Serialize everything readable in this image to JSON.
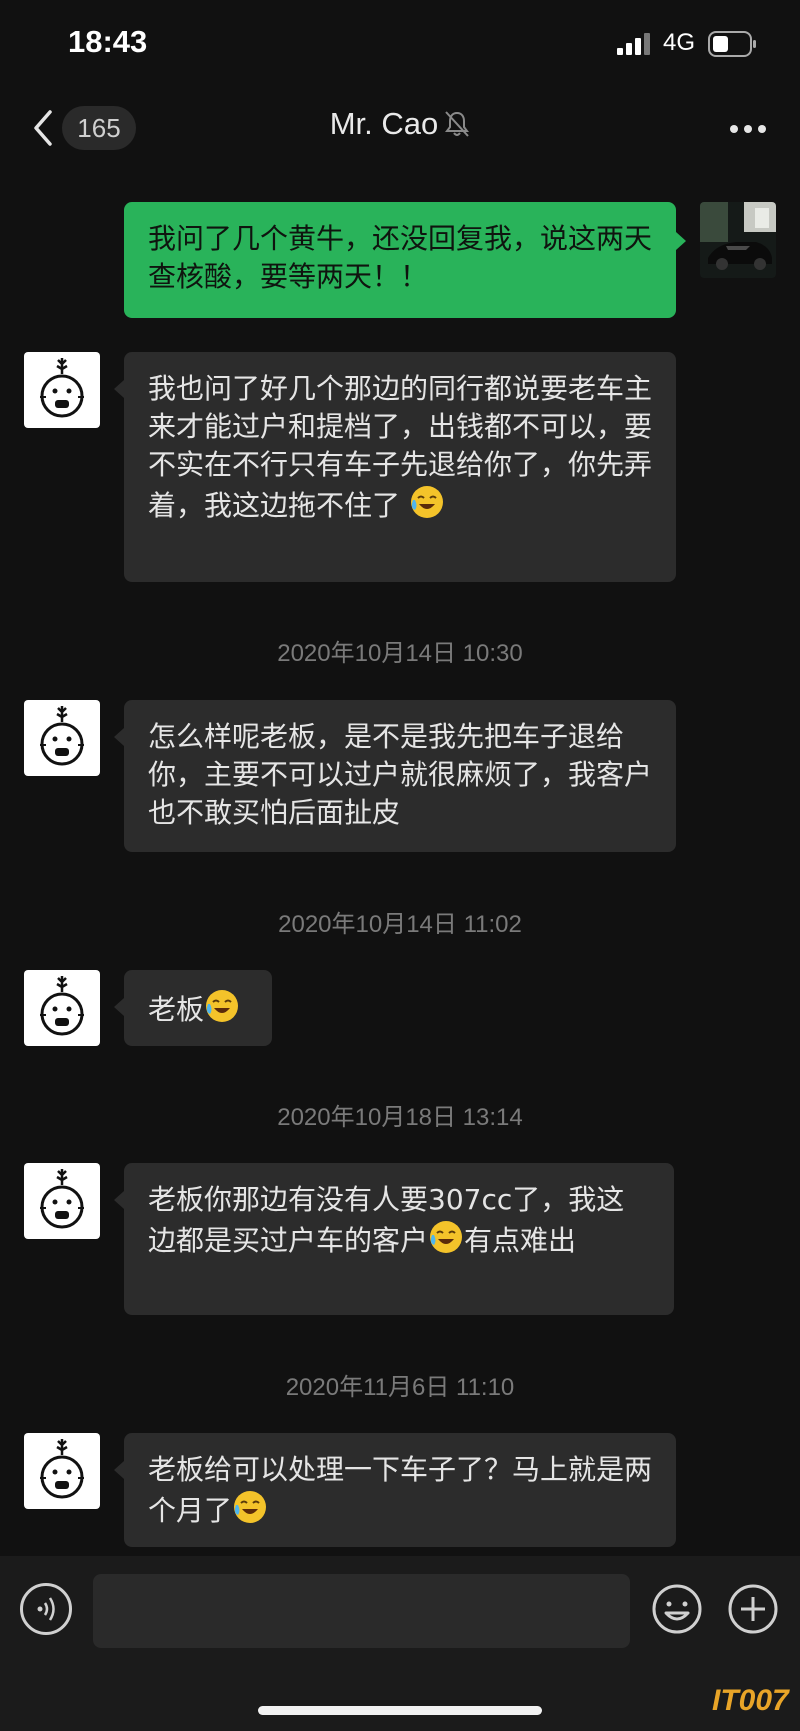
{
  "status_bar": {
    "time": "18:43",
    "network": "4G"
  },
  "nav": {
    "unread_count": "165",
    "title": "Mr. Cao"
  },
  "messages": [
    {
      "text": "我问了几个黄牛，还没回复我，说这两天查核酸，要等两天！！"
    },
    {
      "text": "我也问了好几个那边的同行都说要老车主来才能过户和提档了，出钱都不可以，要不实在不行只有车子先退给你了，你先弄着，我这边拖不住了"
    },
    {
      "timestamp": "2020年10月14日 10:30"
    },
    {
      "text": "怎么样呢老板，是不是我先把车子退给你，主要不可以过户就很麻烦了，我客户也不敢买怕后面扯皮"
    },
    {
      "timestamp": "2020年10月14日 11:02"
    },
    {
      "text": "老板"
    },
    {
      "timestamp": "2020年10月18日 13:14"
    },
    {
      "text_before": "老板你那边有没有人要307cc了，我这边都是买过户车的客户",
      "text_after": "有点难出"
    },
    {
      "timestamp": "2020年11月6日 11:10"
    },
    {
      "text": "老板给可以处理一下车子了？马上就是两个月了"
    }
  ],
  "input": {
    "placeholder": ""
  },
  "watermark": "IT007",
  "colors": {
    "bubble_out": "#29b35a",
    "bubble_in": "#2c2c2c",
    "background": "#111111"
  }
}
